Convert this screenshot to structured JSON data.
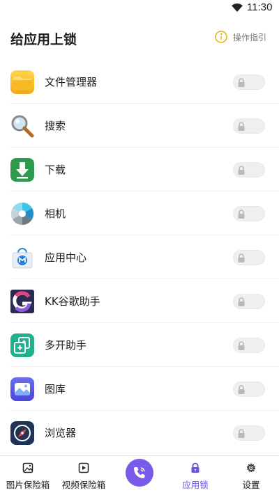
{
  "status_bar": {
    "time": "11:30",
    "wifi_icon": "wifi-icon"
  },
  "header": {
    "title": "给应用上锁",
    "guide_label": "操作指引",
    "guide_icon": "info-icon",
    "accent": "#e6b000"
  },
  "apps": [
    {
      "name": "文件管理器",
      "icon": "folder-icon",
      "locked": false
    },
    {
      "name": "搜索",
      "icon": "magnifier-icon",
      "locked": false
    },
    {
      "name": "下载",
      "icon": "download-icon",
      "locked": false
    },
    {
      "name": "相机",
      "icon": "camera-aperture-icon",
      "locked": false
    },
    {
      "name": "应用中心",
      "icon": "app-store-bag-icon",
      "locked": false
    },
    {
      "name": "KK谷歌助手",
      "icon": "kk-google-g-icon",
      "locked": false
    },
    {
      "name": "多开助手",
      "icon": "multi-open-icon",
      "locked": false
    },
    {
      "name": "图库",
      "icon": "gallery-icon",
      "locked": false
    },
    {
      "name": "浏览器",
      "icon": "compass-icon",
      "locked": false
    }
  ],
  "bottom_nav": {
    "items": [
      {
        "label": "图片保险箱",
        "icon": "image-icon"
      },
      {
        "label": "视频保险箱",
        "icon": "video-icon"
      },
      {
        "label": "应用锁",
        "icon": "lock-icon",
        "active": true
      },
      {
        "label": "设置",
        "icon": "gear-icon"
      }
    ],
    "center_button_icon": "phone-call-icon",
    "active_color": "#6a4fe0"
  }
}
